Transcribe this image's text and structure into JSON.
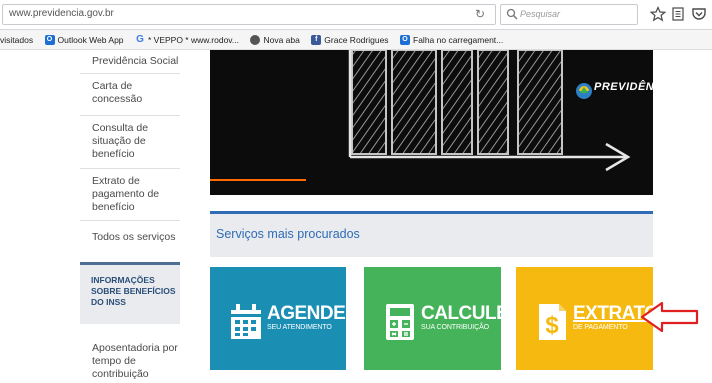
{
  "browser": {
    "url": "www.previdencia.gov.br",
    "search_placeholder": "Pesquisar",
    "bookmarks": [
      {
        "label": "visitados",
        "icon": "none"
      },
      {
        "label": "Outlook Web App",
        "icon": "outlook-icon",
        "color": "#1e6fd1"
      },
      {
        "label": "* VEPPO * www.rodov...",
        "icon": "google-icon",
        "color": "#3b7be8"
      },
      {
        "label": "Nova aba",
        "icon": "firefox-icon",
        "color": "#555555"
      },
      {
        "label": "Grace Rodrigues",
        "icon": "facebook-icon",
        "color": "#3b5998"
      },
      {
        "label": "Falha no carregament...",
        "icon": "outlook-icon",
        "color": "#1e6fd1"
      }
    ]
  },
  "sidebar": {
    "items": [
      "Previdência Social",
      "Carta de concessão",
      "Consulta de situação de benefício",
      "Extrato de pagamento de benefício",
      "Todos os serviços"
    ],
    "info_box": "INFORMAÇÕES SOBRE BENEFÍCIOS DO INSS",
    "after_info": "Aposentadoria por tempo de contribuição"
  },
  "hero": {
    "logo_text": "PREVIDÊN"
  },
  "services": {
    "title": "Serviços mais procurados",
    "tiles": [
      {
        "big": "AGENDE",
        "small": "SEU ATENDIMENTO",
        "color": "#1b8fb3",
        "icon": "calendar-icon"
      },
      {
        "big": "CALCULE",
        "small": "SUA CONTRIBUIÇÃO",
        "color": "#45b35a",
        "icon": "calculator-icon"
      },
      {
        "big": "EXTRATO",
        "small": "DE PAGAMENTO",
        "color": "#f5b90f",
        "icon": "dollar-document-icon"
      }
    ]
  },
  "annotation": {
    "arrow_color": "#e02020"
  }
}
